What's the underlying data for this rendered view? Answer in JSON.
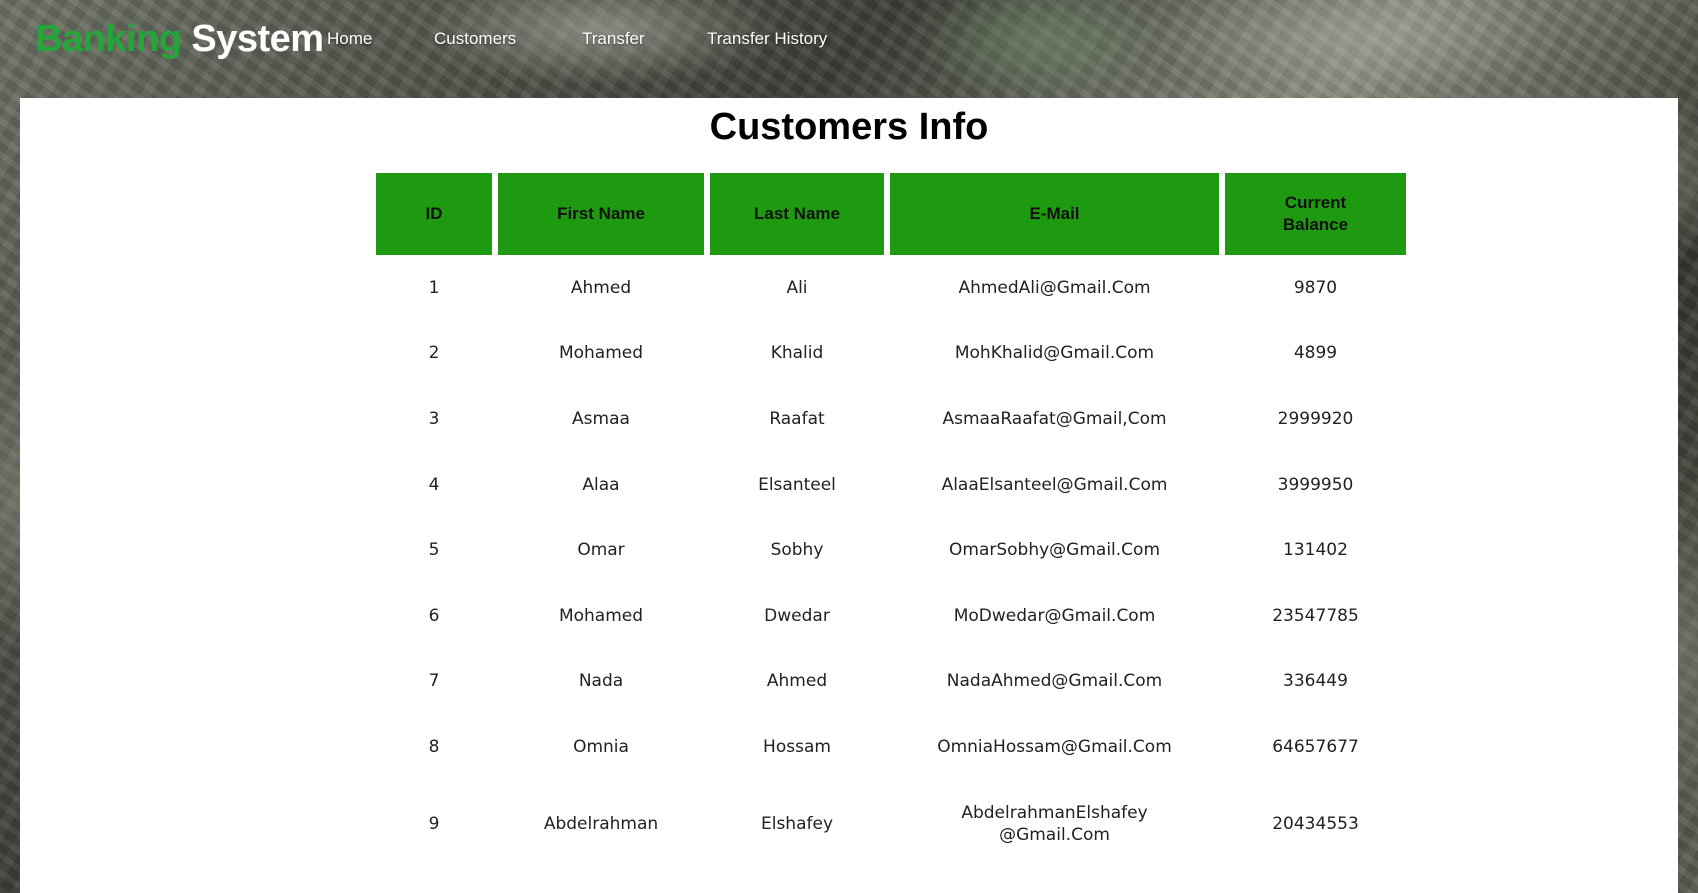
{
  "brand": {
    "part1": "Banking",
    "part2": "System"
  },
  "nav": [
    {
      "label": "Home"
    },
    {
      "label": "Customers"
    },
    {
      "label": "Transfer"
    },
    {
      "label": "Transfer History"
    }
  ],
  "page_title": "Customers Info",
  "table": {
    "headers": {
      "id": "ID",
      "first_name": "First Name",
      "last_name": "Last Name",
      "email": "E-Mail",
      "balance_line1": "Current",
      "balance_line2": "Balance"
    },
    "rows": [
      {
        "id": "1",
        "first": "Ahmed",
        "last": "Ali",
        "email": "AhmedAli@Gmail.Com",
        "email_line2": "",
        "balance": "9870"
      },
      {
        "id": "2",
        "first": "Mohamed",
        "last": "Khalid",
        "email": "MohKhalid@Gmail.Com",
        "email_line2": "",
        "balance": "4899"
      },
      {
        "id": "3",
        "first": "Asmaa",
        "last": "Raafat",
        "email": "AsmaaRaafat@Gmail,Com",
        "email_line2": "",
        "balance": "2999920"
      },
      {
        "id": "4",
        "first": "Alaa",
        "last": "Elsanteel",
        "email": "AlaaElsanteel@Gmail.Com",
        "email_line2": "",
        "balance": "3999950"
      },
      {
        "id": "5",
        "first": "Omar",
        "last": "Sobhy",
        "email": "OmarSobhy@Gmail.Com",
        "email_line2": "",
        "balance": "131402"
      },
      {
        "id": "6",
        "first": "Mohamed",
        "last": "Dwedar",
        "email": "MoDwedar@Gmail.Com",
        "email_line2": "",
        "balance": "23547785"
      },
      {
        "id": "7",
        "first": "Nada",
        "last": "Ahmed",
        "email": "NadaAhmed@Gmail.Com",
        "email_line2": "",
        "balance": "336449"
      },
      {
        "id": "8",
        "first": "Omnia",
        "last": "Hossam",
        "email": "OmniaHossam@Gmail.Com",
        "email_line2": "",
        "balance": "64657677"
      },
      {
        "id": "9",
        "first": "Abdelrahman",
        "last": "Elshafey",
        "email": "AbdelrahmanElshafey",
        "email_line2": "@Gmail.Com",
        "balance": "20434553"
      }
    ]
  },
  "colors": {
    "brand_green": "#25a53a",
    "header_green": "#1e9a10"
  }
}
